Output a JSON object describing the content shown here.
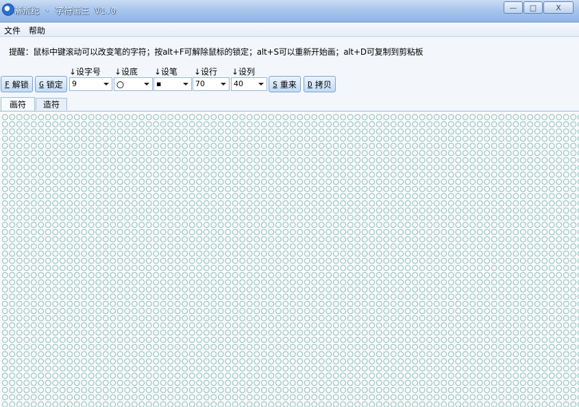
{
  "window": {
    "title": "蒂荒纪 · 字符画王 V1.0",
    "buttons": {
      "minimize": "—",
      "maximize": "□",
      "close": "X"
    }
  },
  "menu": {
    "items": [
      "文件",
      "帮助"
    ]
  },
  "hint": "提醒：鼠标中键滚动可以改变笔的字符；按alt+F可解除鼠标的锁定；alt+S可以重新开始画；alt+D可复制到剪粘板",
  "toolbar": {
    "unlock": {
      "key": "F",
      "label": "解锁"
    },
    "lock": {
      "key": "G",
      "label": "锁定"
    },
    "reset": {
      "key": "S",
      "label": "重来"
    },
    "copy": {
      "key": "D",
      "label": "拷贝"
    },
    "fields": {
      "font_size": {
        "label": "↓设字号",
        "value": "9"
      },
      "background": {
        "label": "↓设底",
        "value": "〇"
      },
      "pen": {
        "label": "↓设笔",
        "value": "▪"
      },
      "rows": {
        "label": "↓设行",
        "value": "70"
      },
      "cols": {
        "label": "↓设列",
        "value": "40"
      }
    }
  },
  "tabs": [
    "画符",
    "造符"
  ],
  "colors": {
    "grid_char": "#9ec6c4",
    "titlebar": "#a9c6ec"
  }
}
